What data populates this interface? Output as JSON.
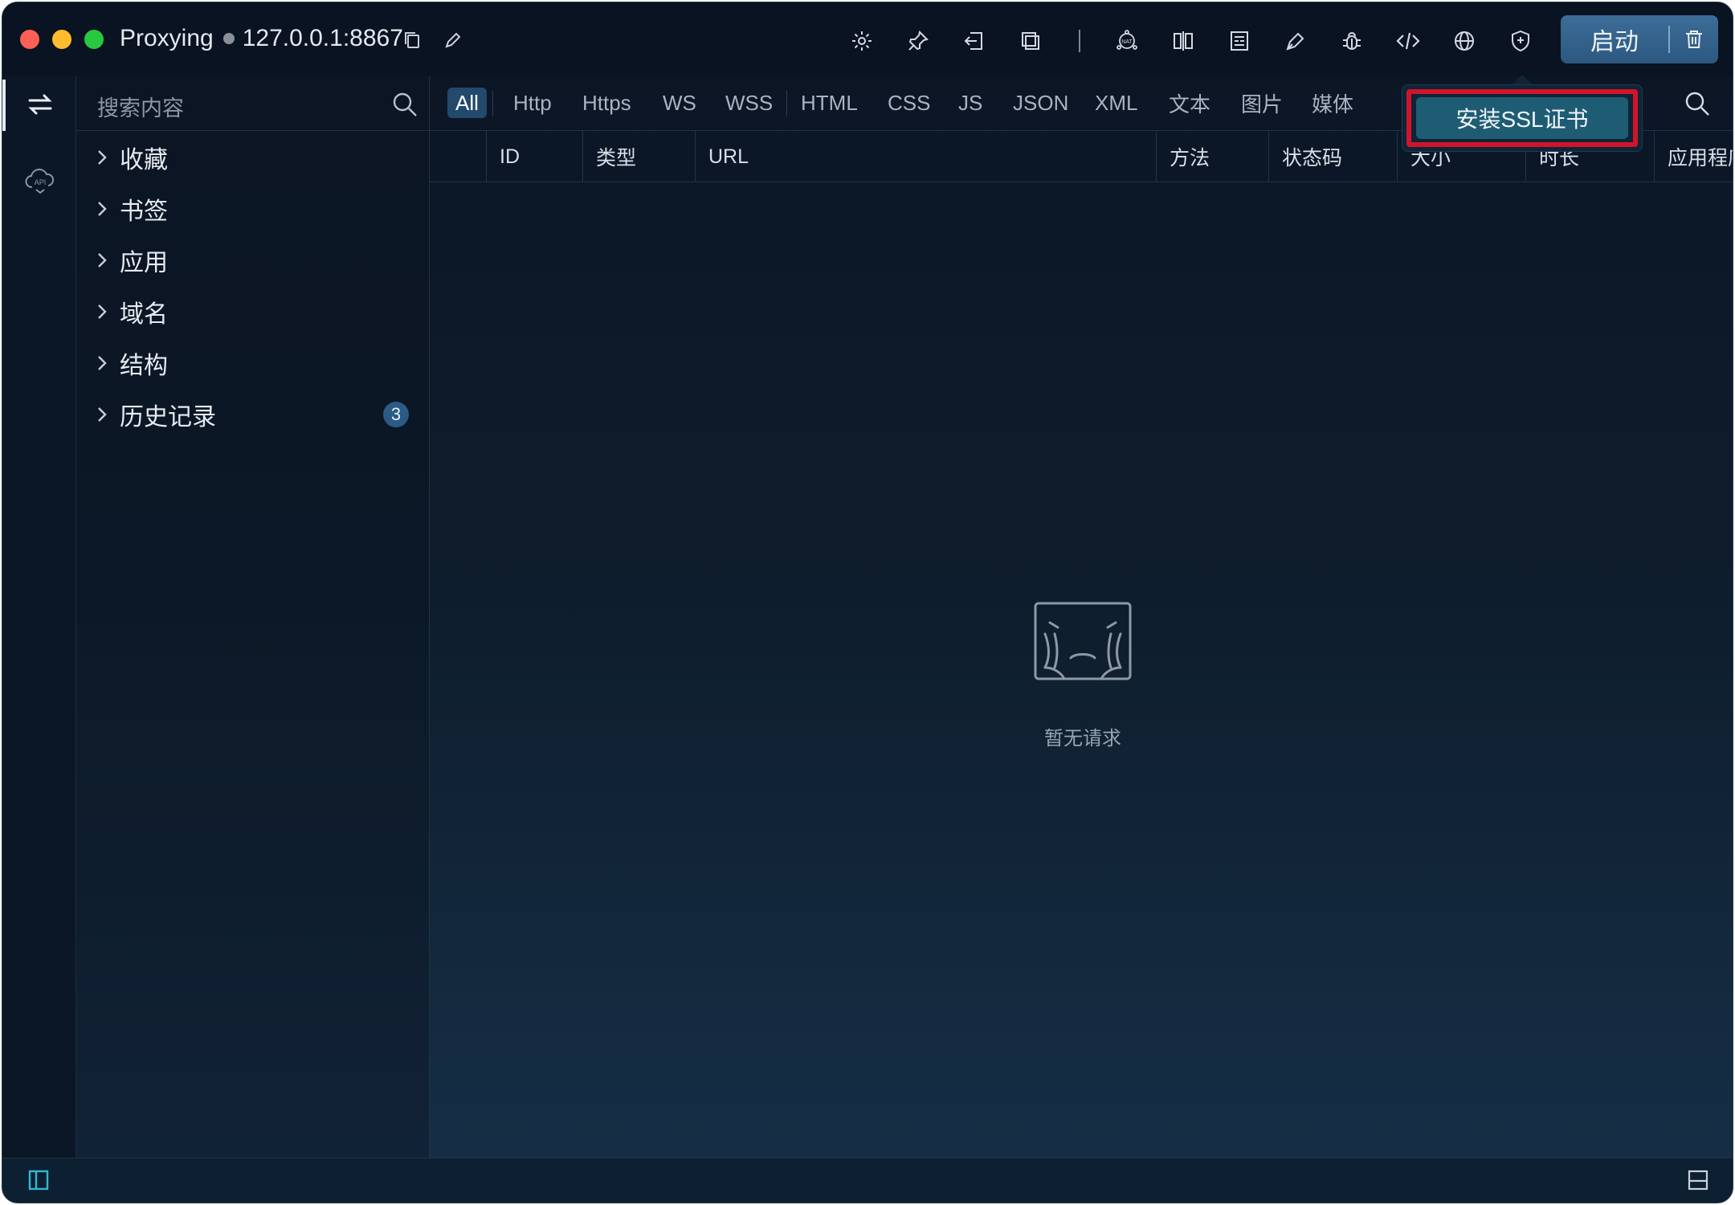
{
  "window": {
    "title": "Proxying",
    "address": "127.0.0.1:8867",
    "toolbar_icons": [
      "gear-icon",
      "pin-icon",
      "exit-icon",
      "copy-window-icon",
      "nat-icon",
      "split-view-icon",
      "compare-icon",
      "pen-icon",
      "bug-icon",
      "code-icon",
      "globe-icon",
      "shield-plus-icon"
    ],
    "start_label": "启动"
  },
  "sidebar": {
    "search_placeholder": "搜索内容",
    "items": [
      {
        "label": "收藏"
      },
      {
        "label": "书签"
      },
      {
        "label": "应用"
      },
      {
        "label": "域名"
      },
      {
        "label": "结构"
      },
      {
        "label": "历史记录",
        "badge": "3"
      }
    ]
  },
  "filters": {
    "tabs": [
      "All",
      "Http",
      "Https",
      "WS",
      "WSS",
      "HTML",
      "CSS",
      "JS",
      "JSON",
      "XML",
      "文本",
      "图片",
      "媒体"
    ],
    "active": "All"
  },
  "table": {
    "columns": [
      "ID",
      "类型",
      "URL",
      "方法",
      "状态码",
      "大小",
      "时长",
      "应用程序"
    ]
  },
  "empty_state": {
    "text": "暂无请求"
  },
  "tooltip": {
    "label": "安装SSL证书"
  },
  "colors": {
    "accent": "#2c5880",
    "highlight": "#d1142a",
    "badge": "#2a5a85"
  }
}
